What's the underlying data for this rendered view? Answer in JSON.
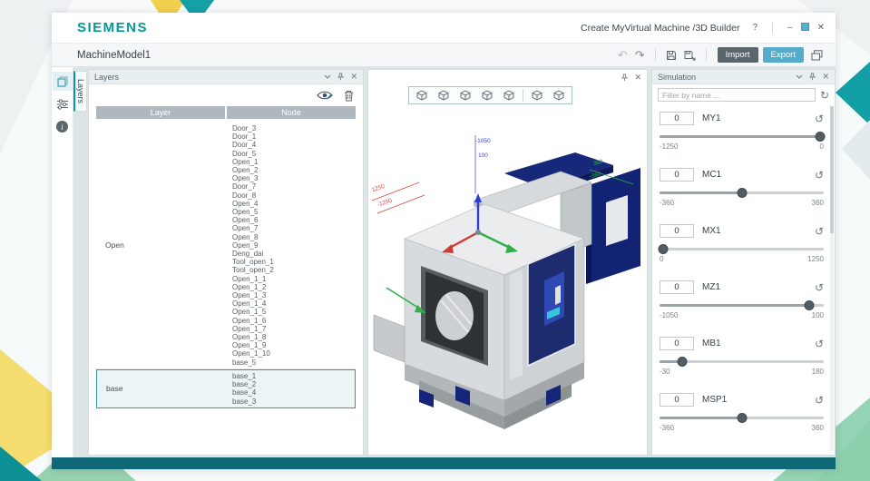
{
  "window": {
    "brand": "SIEMENS",
    "title": "Create MyVirtual Machine /3D Builder"
  },
  "icons": {
    "help": "?",
    "minimize": "‒",
    "close": "✕",
    "undo": "↶",
    "redo": "↷",
    "reset": "↺",
    "refresh": "↻",
    "info": "i"
  },
  "toolbar": {
    "model_name": "MachineModel1",
    "import_label": "Import",
    "export_label": "Export"
  },
  "sidebar": {
    "active_tab": "Layers"
  },
  "layers_panel": {
    "title": "Layers",
    "columns": {
      "layer": "Layer",
      "node": "Node"
    },
    "rows": [
      {
        "layer": "Open",
        "selected": false,
        "nodes": [
          "Door_3",
          "Door_1",
          "Door_4",
          "Door_5",
          "Open_1",
          "Open_2",
          "Open_3",
          "Door_7",
          "Door_8",
          "Open_4",
          "Open_5",
          "Open_6",
          "Open_7",
          "Open_8",
          "Open_9",
          "Deng_dai",
          "Tool_open_1",
          "Tool_open_2",
          "Open_1_1",
          "Open_1_2",
          "Open_1_3",
          "Open_1_4",
          "Open_1_5",
          "Open_1_6",
          "Open_1_7",
          "Open_1_8",
          "Open_1_9",
          "Open_1_10",
          "base_5"
        ]
      },
      {
        "layer": "base",
        "selected": true,
        "nodes": [
          "base_1",
          "base_2",
          "base_4",
          "base_3"
        ]
      }
    ]
  },
  "viewport": {
    "view_cube_count": 7,
    "axis_labels": [
      {
        "text": "1250",
        "color": "#d8433c"
      },
      {
        "text": "-1250",
        "color": "#d8433c"
      },
      {
        "text": "-1050",
        "color": "#3947c9"
      },
      {
        "text": "100",
        "color": "#3947c9"
      },
      {
        "text": "360",
        "color": "#2fae4a"
      },
      {
        "text": "-360",
        "color": "#2fae4a"
      }
    ]
  },
  "simulation": {
    "title": "Simulation",
    "filter_placeholder": "Filter by name ...",
    "axes": [
      {
        "name": "MY1",
        "value": "0",
        "min": "-1250",
        "max": "0",
        "pos": 98
      },
      {
        "name": "MC1",
        "value": "0",
        "min": "-360",
        "max": "360",
        "pos": 50
      },
      {
        "name": "MX1",
        "value": "0",
        "min": "0",
        "max": "1250",
        "pos": 2
      },
      {
        "name": "MZ1",
        "value": "0",
        "min": "-1050",
        "max": "100",
        "pos": 91
      },
      {
        "name": "MB1",
        "value": "0",
        "min": "-30",
        "max": "180",
        "pos": 14
      },
      {
        "name": "MSP1",
        "value": "0",
        "min": "-360",
        "max": "360",
        "pos": 50
      }
    ]
  },
  "colors": {
    "brand_teal": "#009999",
    "export_button": "#55abcb",
    "import_button": "#5a666c",
    "selection_teal": "#2a9aa8",
    "status_bar": "#0e6875"
  }
}
